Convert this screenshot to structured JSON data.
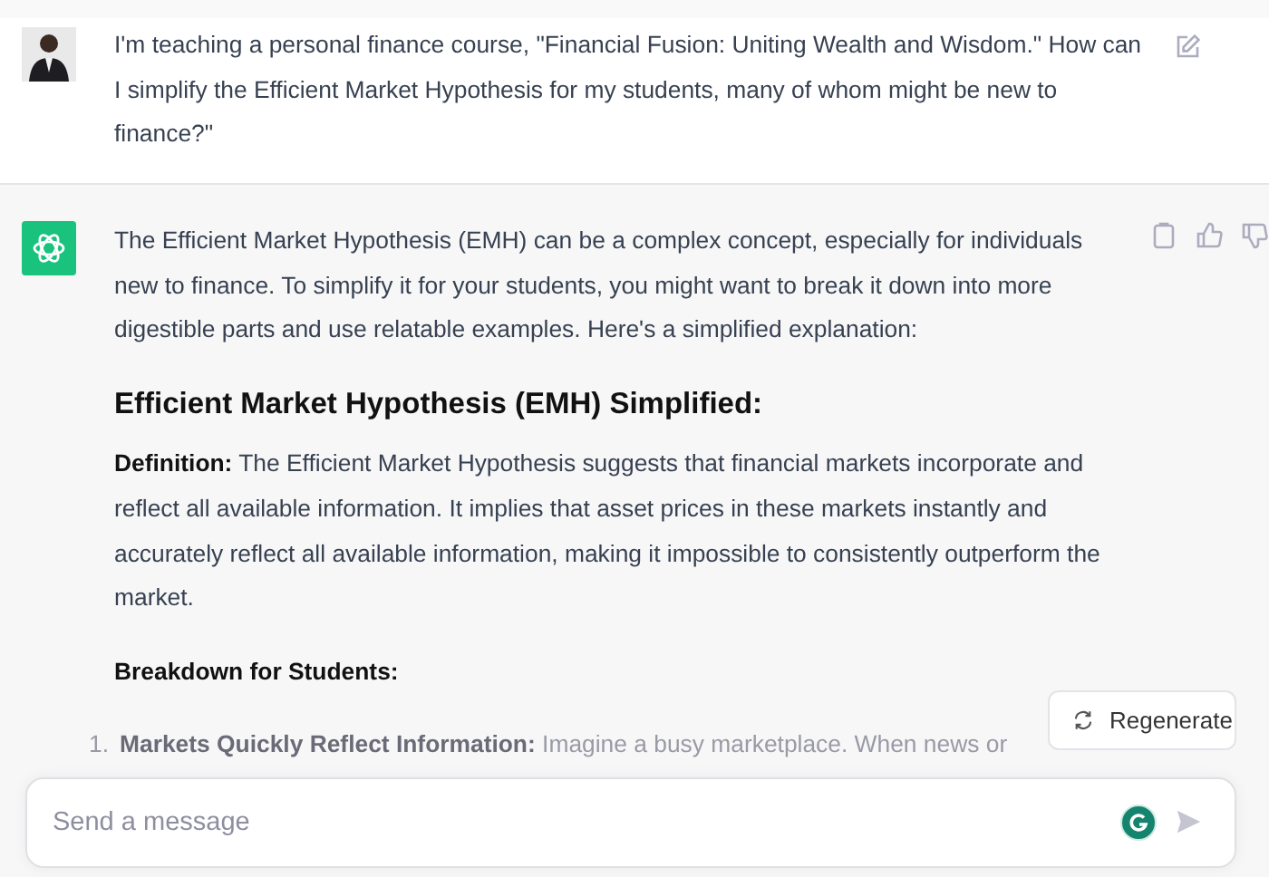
{
  "messages": [
    {
      "kind": "user",
      "paragraphs": [
        {
          "kind": "text",
          "text": "I'm teaching a personal finance course, \"Financial Fusion: Uniting Wealth and Wisdom.\" How can I simplify the Efficient Market Hypothesis for my students, many of whom might be new to finance?\""
        }
      ]
    },
    {
      "kind": "assistant",
      "paragraphs": [
        {
          "kind": "text",
          "text": "The Efficient Market Hypothesis (EMH) can be a complex concept, especially for individuals new to finance. To simplify it for your students, you might want to break it down into more digestible parts and use relatable examples. Here's a simplified explanation:"
        },
        {
          "kind": "heading",
          "text": "Efficient Market Hypothesis (EMH) Simplified:"
        },
        {
          "kind": "text",
          "text": "**Definition:** The Efficient Market Hypothesis suggests that financial markets incorporate and reflect all available information. It implies that asset prices in these markets instantly and accurately reflect all available information, making it impossible to consistently outperform the market."
        },
        {
          "kind": "subheading",
          "text": "Breakdown for Students:"
        },
        {
          "kind": "list",
          "items": [
            {
              "number": "1.",
              "text": "**Markets Quickly Reflect Information:** Imagine a busy marketplace. When news or"
            }
          ]
        }
      ]
    }
  ],
  "regenerate_button": "Regenerate",
  "composer": {
    "placeholder": "Send a message"
  }
}
